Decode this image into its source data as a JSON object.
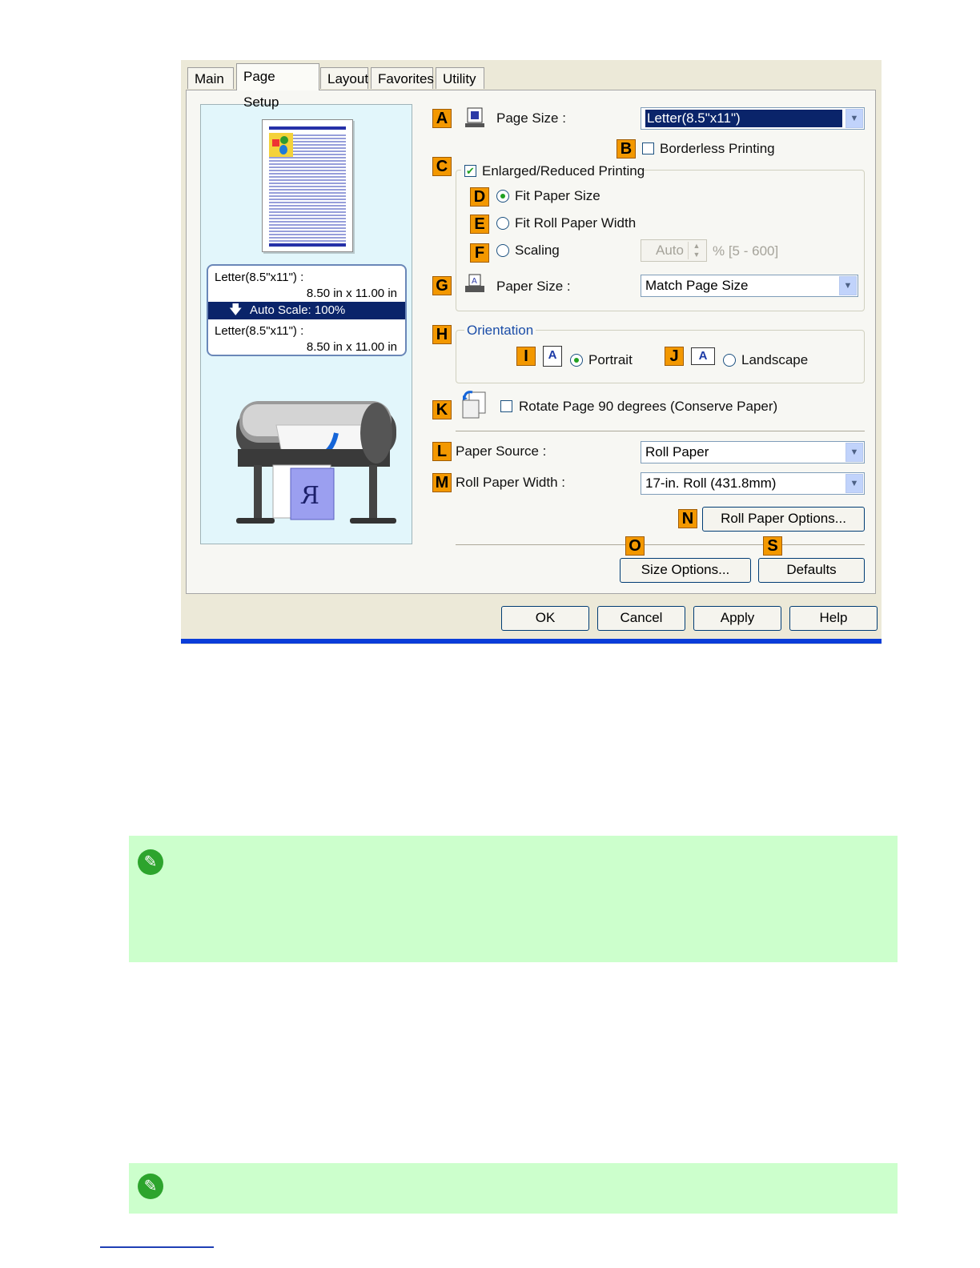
{
  "tabs": [
    "Main",
    "Page Setup",
    "Layout",
    "Favorites",
    "Utility"
  ],
  "preview": {
    "info_top_line1": "Letter(8.5\"x11\") :",
    "info_top_line2": "8.50 in x 11.00 in",
    "auto_scale": "Auto Scale: 100%",
    "info_bottom_line1": "Letter(8.5\"x11\") :",
    "info_bottom_line2": "8.50 in x 11.00 in",
    "sheet_letter": "R"
  },
  "callouts": [
    "A",
    "B",
    "C",
    "D",
    "E",
    "F",
    "G",
    "H",
    "I",
    "J",
    "K",
    "L",
    "M",
    "N",
    "O",
    "S"
  ],
  "settings": {
    "page_size_label": "Page Size :",
    "page_size_value": "Letter(8.5\"x11\")",
    "borderless_label": "Borderless Printing",
    "enlarged_label": "Enlarged/Reduced Printing",
    "fit_paper_label": "Fit Paper Size",
    "fit_roll_label": "Fit Roll Paper Width",
    "scaling_label": "Scaling",
    "scaling_value": "Auto",
    "scaling_range": "% [5 - 600]",
    "paper_size_label": "Paper Size :",
    "paper_size_value": "Match Page Size",
    "orientation_label": "Orientation",
    "portrait_label": "Portrait",
    "landscape_label": "Landscape",
    "orientation_icon_letter": "A",
    "rotate_label": "Rotate Page 90 degrees (Conserve Paper)",
    "paper_source_label": "Paper Source :",
    "paper_source_value": "Roll Paper",
    "roll_width_label": "Roll Paper Width :",
    "roll_width_value": "17-in. Roll (431.8mm)",
    "roll_options_btn": "Roll Paper Options...",
    "size_options_btn": "Size Options...",
    "defaults_btn": "Defaults"
  },
  "footer": {
    "ok": "OK",
    "cancel": "Cancel",
    "apply": "Apply",
    "help": "Help"
  },
  "colors": {
    "callout": "#f39800",
    "note_bg": "#ccffcc",
    "selection": "#0a246a",
    "preview_bg": "#e2f6fb"
  }
}
